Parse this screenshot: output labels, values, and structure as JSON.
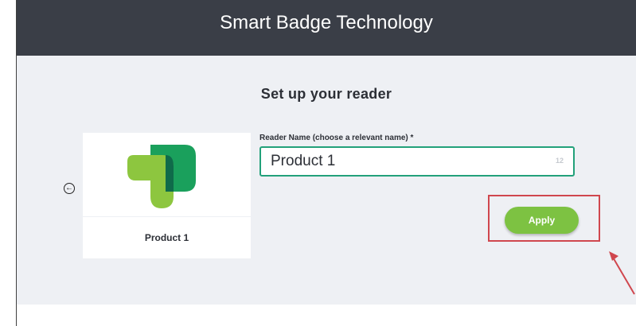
{
  "header": {
    "title": "Smart Badge Technology"
  },
  "main": {
    "title": "Set up your reader",
    "card": {
      "label": "Product 1"
    },
    "field": {
      "label": "Reader Name (choose a relevant name) *",
      "value": "Product 1",
      "counter": "12"
    },
    "apply_label": "Apply",
    "back_icon": "back-arrow-circle-icon"
  },
  "colors": {
    "header_bg": "#3a3e47",
    "panel_bg": "#eef0f4",
    "field_border": "#22a17a",
    "button_bg": "#7dc242",
    "highlight": "#d0474e"
  }
}
